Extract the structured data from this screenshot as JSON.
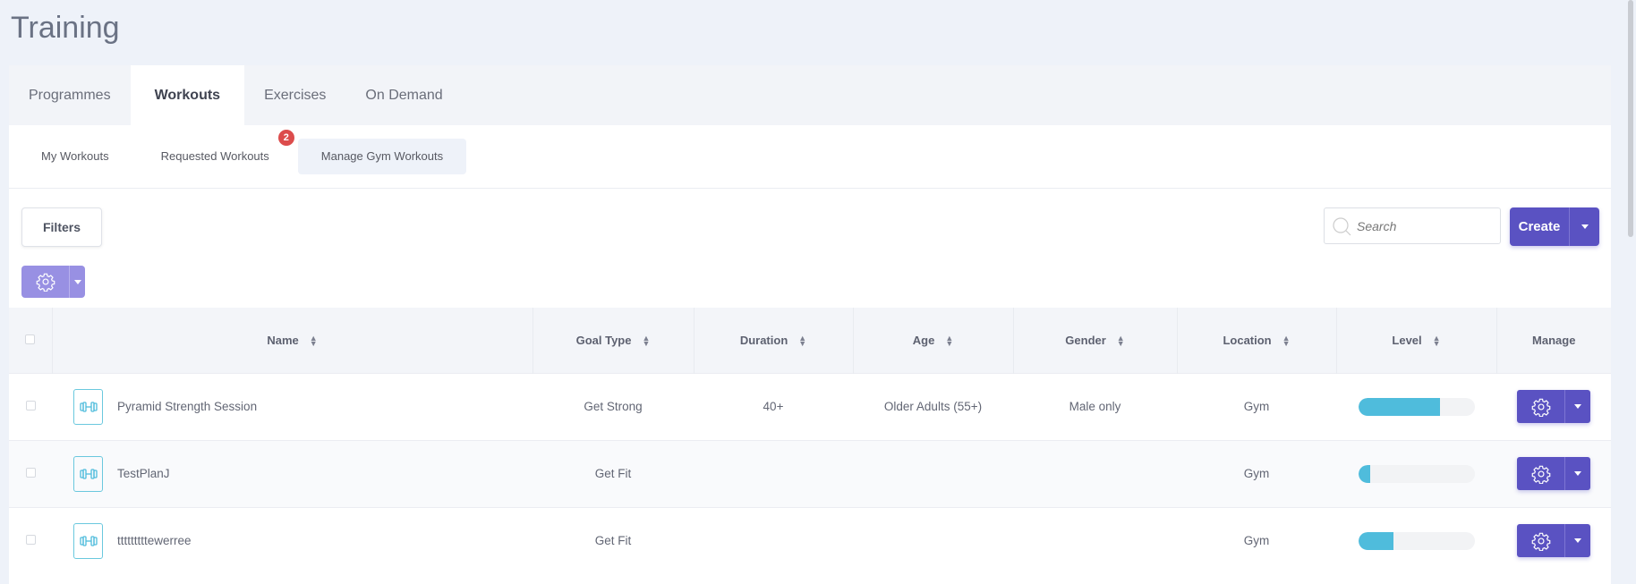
{
  "page_title": "Training",
  "tabs": [
    {
      "label": "Programmes"
    },
    {
      "label": "Workouts",
      "active": true
    },
    {
      "label": "Exercises"
    },
    {
      "label": "On Demand"
    }
  ],
  "subtabs": [
    {
      "label": "My Workouts"
    },
    {
      "label": "Requested Workouts",
      "badge": "2"
    },
    {
      "label": "Manage Gym Workouts",
      "active": true
    }
  ],
  "toolbar": {
    "filters_label": "Filters",
    "search_placeholder": "Search",
    "create_label": "Create"
  },
  "columns": [
    "Name",
    "Goal Type",
    "Duration",
    "Age",
    "Gender",
    "Location",
    "Level",
    "Manage"
  ],
  "rows": [
    {
      "name": "Pyramid Strength Session",
      "goal": "Get Strong",
      "duration": "40+",
      "age": "Older Adults (55+)",
      "gender": "Male only",
      "location": "Gym",
      "level_percent": 70
    },
    {
      "name": "TestPlanJ",
      "goal": "Get Fit",
      "duration": "",
      "age": "",
      "gender": "",
      "location": "Gym",
      "level_percent": 10
    },
    {
      "name": "tttttttttewerree",
      "goal": "Get Fit",
      "duration": "",
      "age": "",
      "gender": "",
      "location": "Gym",
      "level_percent": 30
    }
  ],
  "colors": {
    "primary": "#5a52c2",
    "primary_light": "#9890e3",
    "level_fill": "#4fbcdc",
    "badge": "#dc4c4c"
  },
  "icons": {
    "row_icon": "dumbbell-icon",
    "settings": "gear-icon",
    "search": "search-icon",
    "sort": "sort-icon",
    "dropdown": "caret-down-icon"
  }
}
